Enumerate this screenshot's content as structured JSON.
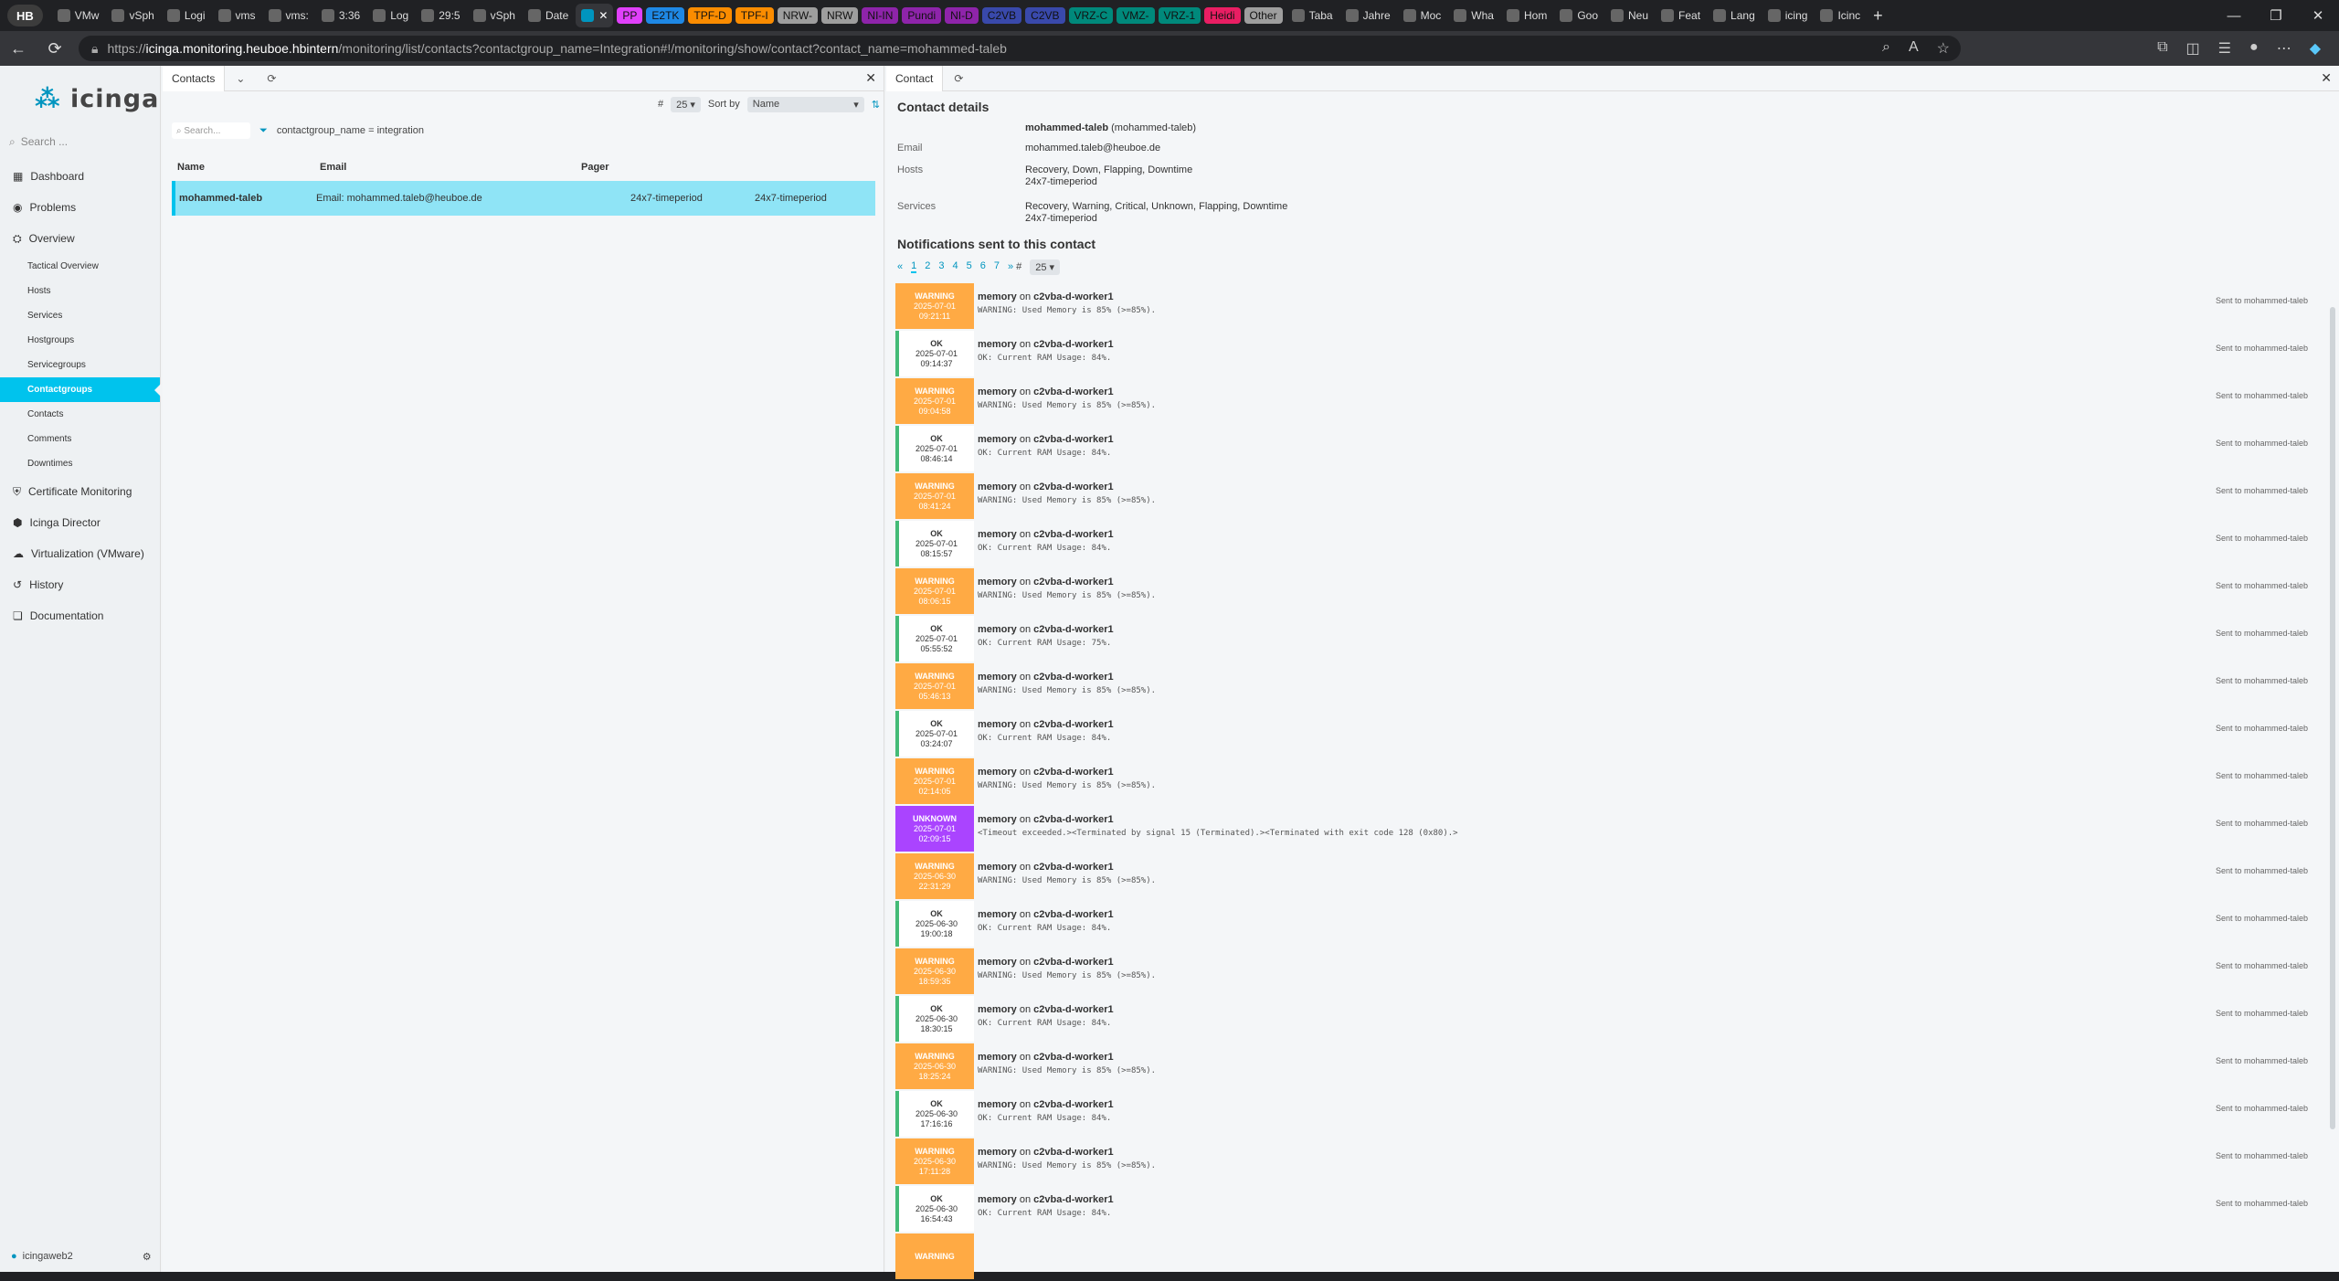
{
  "browser": {
    "profile": "HB",
    "tabs": [
      "VMw",
      "vSph",
      "Logi",
      "vms",
      "vms:",
      "3:36",
      "Log",
      "29:5",
      "vSph",
      "Date"
    ],
    "groups": [
      {
        "label": "PP",
        "color": "#e040fb"
      },
      {
        "label": "E2TK",
        "color": "#1e88e5"
      },
      {
        "label": "TPF-D",
        "color": "#fb8c00"
      },
      {
        "label": "TPF-I",
        "color": "#fb8c00"
      },
      {
        "label": "NRW-",
        "color": "#9e9e9e"
      },
      {
        "label": "NRW",
        "color": "#9e9e9e"
      },
      {
        "label": "NI-IN",
        "color": "#8e24aa"
      },
      {
        "label": "Pundi",
        "color": "#8e24aa"
      },
      {
        "label": "NI-D",
        "color": "#8e24aa"
      },
      {
        "label": "C2VB",
        "color": "#3949ab"
      },
      {
        "label": "C2VB",
        "color": "#3949ab"
      },
      {
        "label": "VRZ-C",
        "color": "#00897b"
      },
      {
        "label": "VMZ-",
        "color": "#00897b"
      },
      {
        "label": "VRZ-1",
        "color": "#00897b"
      },
      {
        "label": "Heidi",
        "color": "#e91e63"
      },
      {
        "label": "Other",
        "color": "#9e9e9e"
      }
    ],
    "tabs2": [
      "Taba",
      "Jahre",
      "Moc",
      "Wha",
      "Hom",
      "Goo",
      "Neu",
      "Feat",
      "Lang",
      "icing",
      "Icinc"
    ],
    "url_prefix": "https://",
    "url_host": "icinga.monitoring.heuboe.hbintern",
    "url_path": "/monitoring/list/contacts?contactgroup_name=Integration#!/monitoring/show/contact?contact_name=mohammed-taleb"
  },
  "sidebar": {
    "brand": "icinga",
    "search_placeholder": "Search ...",
    "items": [
      {
        "label": "Dashboard",
        "icon": "dashboard-icon"
      },
      {
        "label": "Problems",
        "icon": "problems-icon"
      },
      {
        "label": "Overview",
        "icon": "binoculars-icon"
      }
    ],
    "subitems": [
      "Tactical Overview",
      "Hosts",
      "Services",
      "Hostgroups",
      "Servicegroups",
      "Contactgroups",
      "Contacts",
      "Comments",
      "Downtimes"
    ],
    "items2": [
      "Certificate Monitoring",
      "Icinga Director",
      "Virtualization (VMware)",
      "History",
      "Documentation"
    ],
    "user": "icingaweb2"
  },
  "left": {
    "tab": "Contacts",
    "limit_label": "#",
    "limit": "25",
    "sort_label": "Sort by",
    "sort_value": "Name",
    "search_placeholder": "Search...",
    "filter": "contactgroup_name = integration",
    "headers": {
      "name": "Name",
      "email": "Email",
      "pager": "Pager"
    },
    "row": {
      "name": "mohammed-taleb",
      "email": "Email: mohammed.taleb@heuboe.de",
      "tp1": "24x7-timeperiod",
      "tp2": "24x7-timeperiod"
    }
  },
  "right": {
    "tab": "Contact",
    "details_title": "Contact details",
    "contact_name": "mohammed-taleb",
    "contact_alias": "(mohammed-taleb)",
    "email_label": "Email",
    "email": "mohammed.taleb@heuboe.de",
    "hosts_label": "Hosts",
    "hosts_events": "Recovery, Down, Flapping, Downtime",
    "hosts_tp": "24x7-timeperiod",
    "services_label": "Services",
    "services_events": "Recovery, Warning, Critical, Unknown, Flapping, Downtime",
    "services_tp": "24x7-timeperiod",
    "notif_title": "Notifications sent to this contact",
    "pager": {
      "prev": "«",
      "pages": [
        "1",
        "2",
        "3",
        "4",
        "5",
        "6",
        "7"
      ],
      "next": "»",
      "limit_label": "#",
      "limit": "25"
    },
    "sent_to": "Sent to mohammed-taleb",
    "on": "on",
    "notifications": [
      {
        "state": "WARNING",
        "date": "2025-07-01",
        "time": "09:21:11",
        "service": "memory",
        "host": "c2vba-d-worker1",
        "output": "WARNING: Used Memory is 85% (>=85%)."
      },
      {
        "state": "OK",
        "date": "2025-07-01",
        "time": "09:14:37",
        "service": "memory",
        "host": "c2vba-d-worker1",
        "output": "OK: Current RAM Usage: 84%."
      },
      {
        "state": "WARNING",
        "date": "2025-07-01",
        "time": "09:04:58",
        "service": "memory",
        "host": "c2vba-d-worker1",
        "output": "WARNING: Used Memory is 85% (>=85%)."
      },
      {
        "state": "OK",
        "date": "2025-07-01",
        "time": "08:46:14",
        "service": "memory",
        "host": "c2vba-d-worker1",
        "output": "OK: Current RAM Usage: 84%."
      },
      {
        "state": "WARNING",
        "date": "2025-07-01",
        "time": "08:41:24",
        "service": "memory",
        "host": "c2vba-d-worker1",
        "output": "WARNING: Used Memory is 85% (>=85%)."
      },
      {
        "state": "OK",
        "date": "2025-07-01",
        "time": "08:15:57",
        "service": "memory",
        "host": "c2vba-d-worker1",
        "output": "OK: Current RAM Usage: 84%."
      },
      {
        "state": "WARNING",
        "date": "2025-07-01",
        "time": "08:06:15",
        "service": "memory",
        "host": "c2vba-d-worker1",
        "output": "WARNING: Used Memory is 85% (>=85%)."
      },
      {
        "state": "OK",
        "date": "2025-07-01",
        "time": "05:55:52",
        "service": "memory",
        "host": "c2vba-d-worker1",
        "output": "OK: Current RAM Usage: 75%."
      },
      {
        "state": "WARNING",
        "date": "2025-07-01",
        "time": "05:46:13",
        "service": "memory",
        "host": "c2vba-d-worker1",
        "output": "WARNING: Used Memory is 85% (>=85%)."
      },
      {
        "state": "OK",
        "date": "2025-07-01",
        "time": "03:24:07",
        "service": "memory",
        "host": "c2vba-d-worker1",
        "output": "OK: Current RAM Usage: 84%."
      },
      {
        "state": "WARNING",
        "date": "2025-07-01",
        "time": "02:14:05",
        "service": "memory",
        "host": "c2vba-d-worker1",
        "output": "WARNING: Used Memory is 85% (>=85%)."
      },
      {
        "state": "UNKNOWN",
        "date": "2025-07-01",
        "time": "02:09:15",
        "service": "memory",
        "host": "c2vba-d-worker1",
        "output": "<Timeout exceeded.><Terminated by signal 15 (Terminated).><Terminated with exit code 128 (0x80).>"
      },
      {
        "state": "WARNING",
        "date": "2025-06-30",
        "time": "22:31:29",
        "service": "memory",
        "host": "c2vba-d-worker1",
        "output": "WARNING: Used Memory is 85% (>=85%)."
      },
      {
        "state": "OK",
        "date": "2025-06-30",
        "time": "19:00:18",
        "service": "memory",
        "host": "c2vba-d-worker1",
        "output": "OK: Current RAM Usage: 84%."
      },
      {
        "state": "WARNING",
        "date": "2025-06-30",
        "time": "18:59:35",
        "service": "memory",
        "host": "c2vba-d-worker1",
        "output": "WARNING: Used Memory is 85% (>=85%)."
      },
      {
        "state": "OK",
        "date": "2025-06-30",
        "time": "18:30:15",
        "service": "memory",
        "host": "c2vba-d-worker1",
        "output": "OK: Current RAM Usage: 84%."
      },
      {
        "state": "WARNING",
        "date": "2025-06-30",
        "time": "18:25:24",
        "service": "memory",
        "host": "c2vba-d-worker1",
        "output": "WARNING: Used Memory is 85% (>=85%)."
      },
      {
        "state": "OK",
        "date": "2025-06-30",
        "time": "17:16:16",
        "service": "memory",
        "host": "c2vba-d-worker1",
        "output": "OK: Current RAM Usage: 84%."
      },
      {
        "state": "WARNING",
        "date": "2025-06-30",
        "time": "17:11:28",
        "service": "memory",
        "host": "c2vba-d-worker1",
        "output": "WARNING: Used Memory is 85% (>=85%)."
      },
      {
        "state": "OK",
        "date": "2025-06-30",
        "time": "16:54:43",
        "service": "memory",
        "host": "c2vba-d-worker1",
        "output": "OK: Current RAM Usage: 84%."
      },
      {
        "state": "WARNING",
        "date": "",
        "time": "",
        "service": "",
        "host": "",
        "output": ""
      }
    ]
  }
}
